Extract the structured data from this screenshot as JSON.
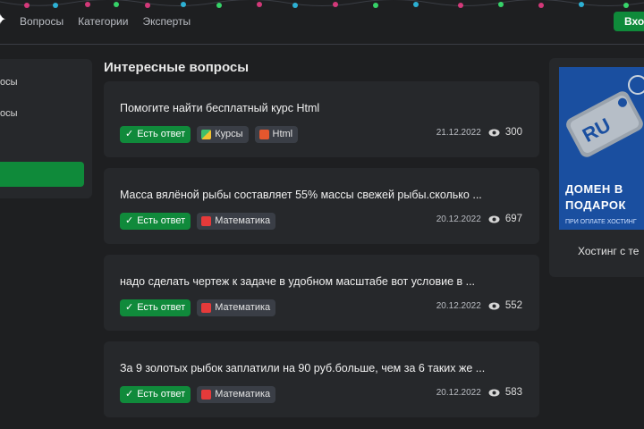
{
  "header": {
    "nav": [
      "Вопросы",
      "Категории",
      "Эксперты"
    ],
    "login_label": "Вход",
    "colors": {
      "accent": "#0f8a3a",
      "background": "#1e1f21"
    }
  },
  "sidebar": {
    "items": [
      "осы",
      "осы"
    ]
  },
  "main": {
    "section_title": "Интересные вопросы",
    "questions": [
      {
        "title": "Помогите найти бесплатный курс Html",
        "answered_label": "Есть ответ",
        "tags": [
          {
            "label": "Курсы",
            "icon": "courses-icon"
          },
          {
            "label": "Html",
            "icon": "html-icon"
          }
        ],
        "date": "21.12.2022",
        "views": "300"
      },
      {
        "title": "Масса вялёной рыбы составляет 55% массы свежей рыбы.сколько ...",
        "answered_label": "Есть ответ",
        "tags": [
          {
            "label": "Математика",
            "icon": "math-icon"
          }
        ],
        "date": "20.12.2022",
        "views": "697"
      },
      {
        "title": "надо сделать чертеж к задаче в удобном масштабе вот условие в ...",
        "answered_label": "Есть ответ",
        "tags": [
          {
            "label": "Математика",
            "icon": "math-icon"
          }
        ],
        "date": "20.12.2022",
        "views": "552"
      },
      {
        "title": "За 9 золотых рыбок заплатили на 90 руб.больше, чем за 6 таких же ...",
        "answered_label": "Есть ответ",
        "tags": [
          {
            "label": "Математика",
            "icon": "math-icon"
          }
        ],
        "date": "20.12.2022",
        "views": "583"
      }
    ]
  },
  "ad": {
    "tag_text": "RU",
    "headline_1": "ДОМЕН В",
    "headline_2": "ПОДАРОК",
    "sub": "ПРИ ОПЛАТЕ ХОСТИНГ",
    "caption": "Хостинг с те"
  }
}
